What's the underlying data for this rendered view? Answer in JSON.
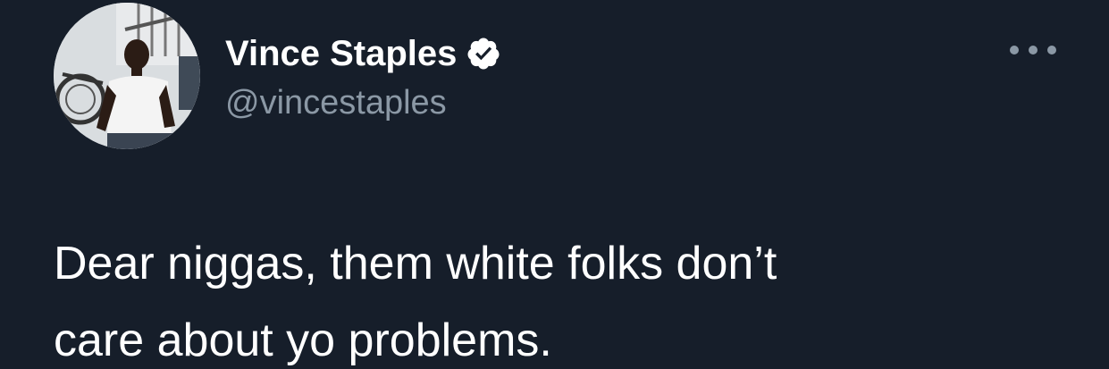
{
  "author": {
    "display_name": "Vince Staples",
    "handle": "@vincestaples",
    "verified_icon": "verified-badge-icon",
    "avatar_icon": "profile-photo"
  },
  "menu": {
    "more_icon": "more-horizontal-icon"
  },
  "tweet": {
    "text": "Dear niggas, them white folks don’t\ncare about yo problems."
  },
  "colors": {
    "background": "#161e2a",
    "primary_text": "#ffffff",
    "secondary_text": "#8b98a5"
  }
}
